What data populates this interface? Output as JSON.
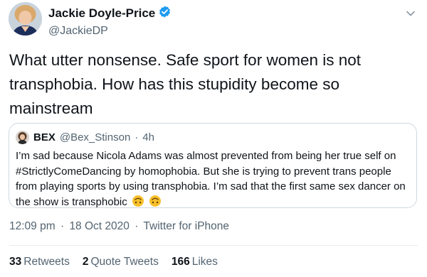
{
  "author": {
    "name": "Jackie Doyle-Price",
    "handle": "@JackieDP",
    "verified_color": "#1d9bf0"
  },
  "tweet_text": "What utter nonsense. Safe sport for women is not transphobia. How has this stupidity become so mainstream",
  "quoted": {
    "name": "BEX",
    "handle": "@Bex_Stinson",
    "separator": "·",
    "time": "4h",
    "text": "I’m sad because Nicola Adams was almost prevented from being her true self on #StrictlyComeDancing by homophobia. But she is trying to prevent trans people from playing sports by using transphobia. I’m sad that the first same sex dancer on the show is transphobic",
    "emoji": [
      "upside-down-face-icon",
      "upside-down-face-icon"
    ]
  },
  "meta": {
    "time": "12:09 pm",
    "sep1": "·",
    "date": "18 Oct 2020",
    "sep2": "·",
    "source": "Twitter for iPhone"
  },
  "stats": {
    "retweets_count": "33",
    "retweets_label": "Retweets",
    "quotes_count": "2",
    "quotes_label": "Quote Tweets",
    "likes_count": "166",
    "likes_label": "Likes"
  },
  "colors": {
    "text": "#0f1419",
    "secondary": "#536471",
    "border": "#cfd9de",
    "verified": "#1d9bf0",
    "emoji": "#f7c02b"
  }
}
